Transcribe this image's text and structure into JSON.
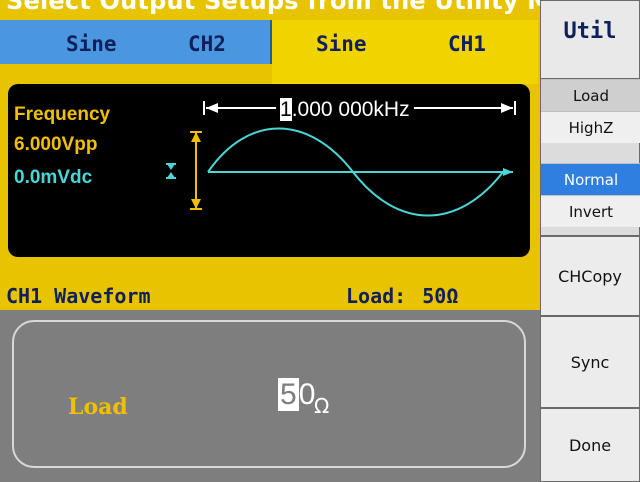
{
  "caption": "Select Output Setups from the Utility Menu to se",
  "tabs": {
    "ch2": {
      "waveform": "Sine",
      "channel": "CH2"
    },
    "ch1": {
      "waveform": "Sine",
      "channel": "CH1"
    }
  },
  "display": {
    "frequency_label": "Frequency",
    "amplitude": "6.000Vpp",
    "offset": "0.0mVdc",
    "frequency_cursor_digit": "1",
    "frequency_rest": ".000 000kHz",
    "colors": {
      "wave": "#4ad6d6",
      "marker": "#f0c000",
      "amp_label": "#f0c000",
      "offset_label": "#4ad6d6"
    }
  },
  "status": {
    "left": "CH1 Waveform",
    "load_label": "Load:",
    "load_value": "50",
    "load_unit": "Ω"
  },
  "bottom": {
    "param_label": "Load",
    "value_caret": "5",
    "value_rest": "0",
    "unit": "Ω"
  },
  "softkeys": {
    "title": "Util",
    "load_header": "Load",
    "highz": "HighZ",
    "normal": "Normal",
    "invert": "Invert",
    "chcopy": "CHCopy",
    "sync": "Sync",
    "done": "Done"
  }
}
